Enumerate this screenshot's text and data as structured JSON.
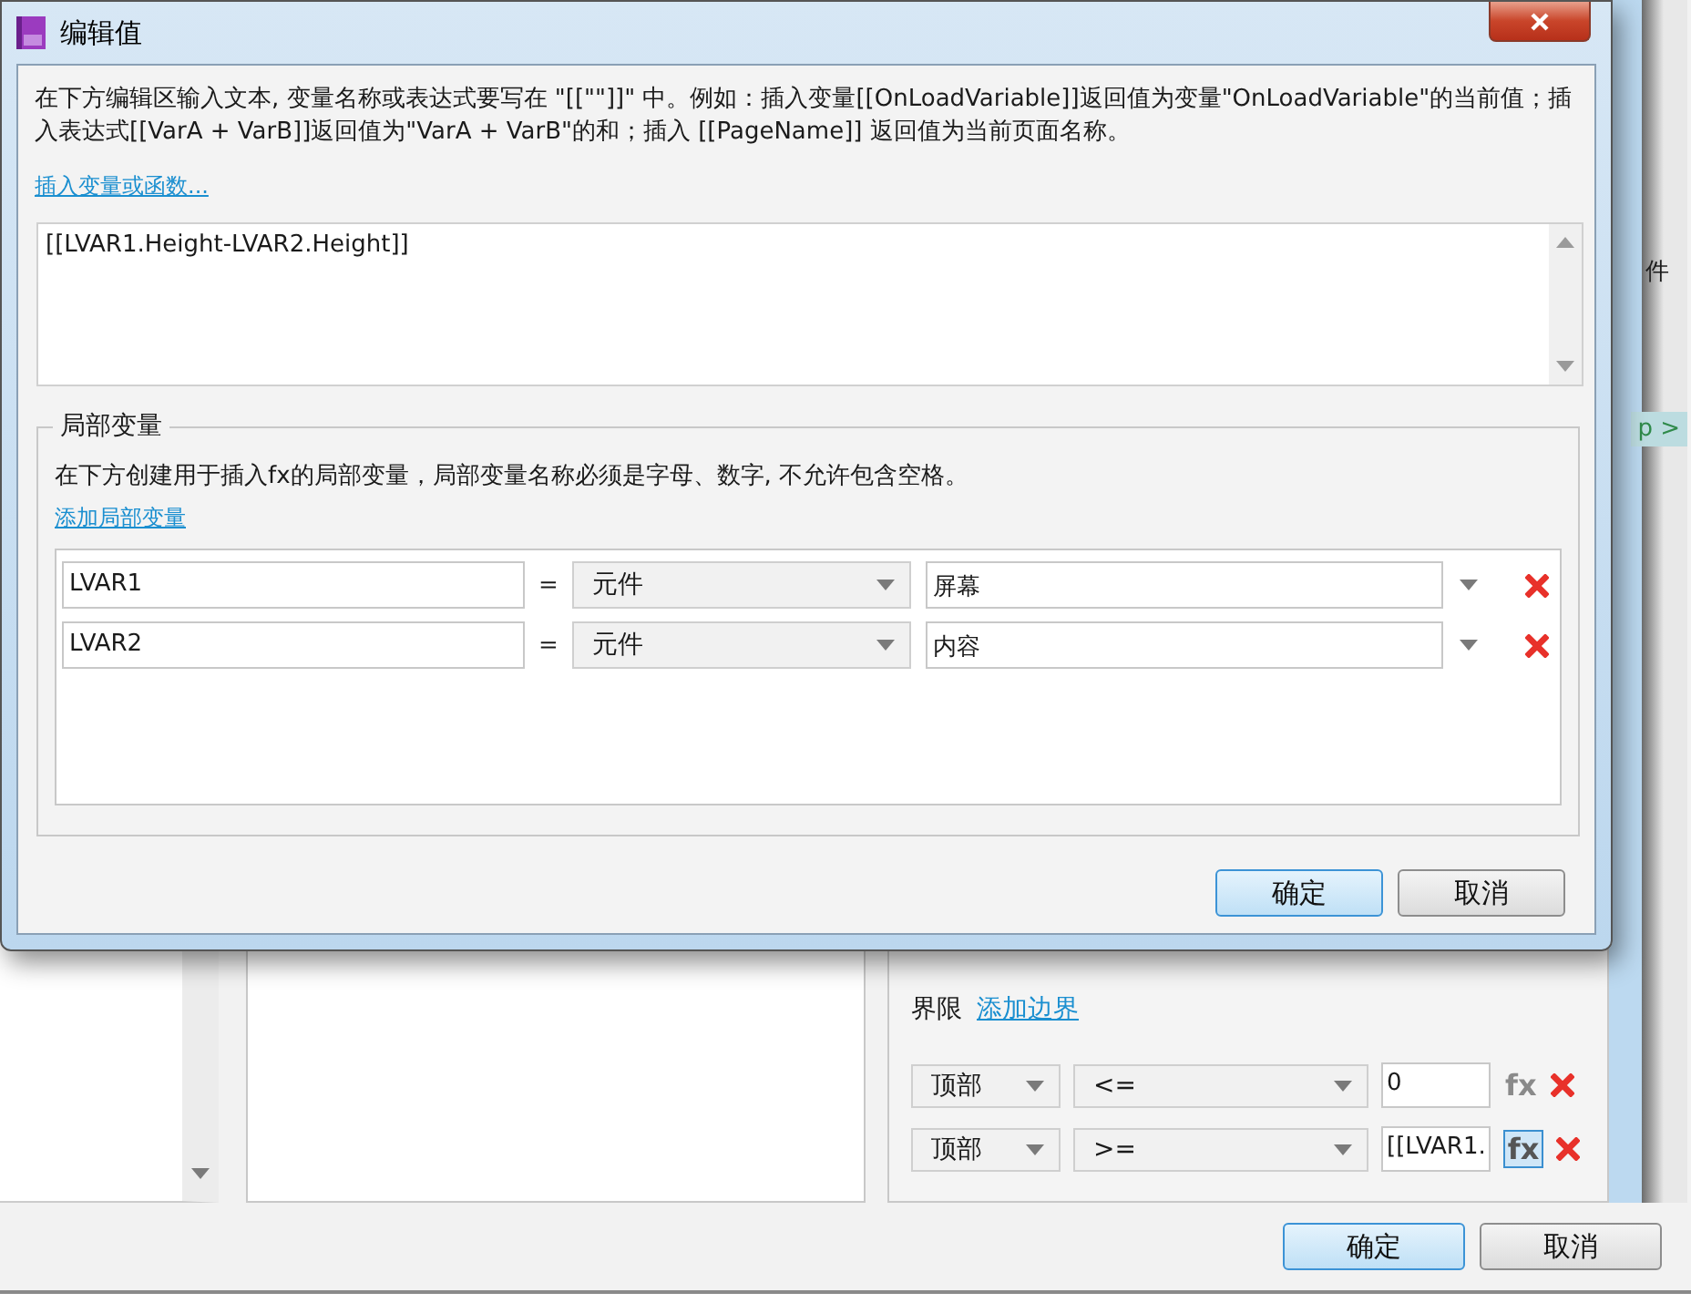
{
  "dialog": {
    "title": "编辑值",
    "description": "在下方编辑区输入文本, 变量名称或表达式要写在 \"[[\"\"]]\" 中。例如：插入变量[[OnLoadVariable]]返回值为变量\"OnLoadVariable\"的当前值；插入表达式[[VarA + VarB]]返回值为\"VarA + VarB\"的和；插入 [[PageName]] 返回值为当前页面名称。",
    "insert_link": "插入变量或函数...",
    "expression": "[[LVAR1.Height-LVAR2.Height]]",
    "local_vars": {
      "legend": "局部变量",
      "description": "在下方创建用于插入fx的局部变量，局部变量名称必须是字母、数字, 不允许包含空格。",
      "add_link": "添加局部变量",
      "rows": [
        {
          "name": "LVAR1",
          "op": "=",
          "type": "元件",
          "target": "屏幕"
        },
        {
          "name": "LVAR2",
          "op": "=",
          "type": "元件",
          "target": "内容"
        }
      ]
    },
    "buttons": [
      {
        "label": "确定",
        "default": true
      },
      {
        "label": "取消",
        "default": false
      }
    ]
  },
  "background": {
    "side_texts": [
      "件",
      "p >"
    ],
    "bounds": {
      "label": "界限",
      "add_link": "添加边界",
      "rows": [
        {
          "edge": "顶部",
          "op": "<=",
          "value": "0",
          "fx": "fx",
          "fx_active": false
        },
        {
          "edge": "顶部",
          "op": ">=",
          "value": "[[LVAR1.",
          "fx": "fx",
          "fx_active": true
        }
      ]
    },
    "buttons": [
      {
        "label": "确定",
        "default": true
      },
      {
        "label": "取消",
        "default": false
      }
    ]
  }
}
